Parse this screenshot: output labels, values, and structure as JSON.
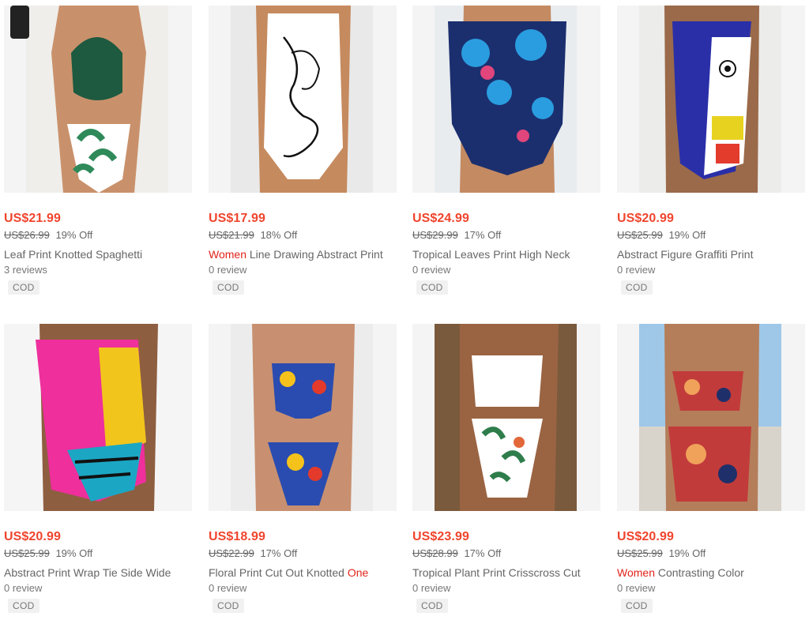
{
  "products": [
    {
      "price": "US$21.99",
      "old_price": "US$26.99",
      "discount": "19% Off",
      "title_highlight": "",
      "title": "Leaf Print Knotted Spaghetti",
      "reviews": "3 reviews",
      "badge": "COD",
      "colors": {
        "bg": "#f3f3f1",
        "suit": "#1d5a40",
        "pattern": "#ffffff",
        "accent": "#2f8a5a",
        "skin": "#c9916b"
      }
    },
    {
      "price": "US$17.99",
      "old_price": "US$21.99",
      "discount": "18% Off",
      "title_highlight": "Women",
      "title": " Line Drawing Abstract Print",
      "reviews": "0 review",
      "badge": "COD",
      "colors": {
        "bg": "#e9e9e9",
        "suit": "#ffffff",
        "pattern": "#111111",
        "accent": "#222222",
        "skin": "#c58a5e"
      }
    },
    {
      "price": "US$24.99",
      "old_price": "US$29.99",
      "discount": "17% Off",
      "title_highlight": "",
      "title": "Tropical Leaves Print High Neck",
      "reviews": "0 review",
      "badge": "COD",
      "colors": {
        "bg": "#e8ecef",
        "suit": "#1b2f6e",
        "pattern": "#2a9de0",
        "accent": "#e0457b",
        "skin": "#c48a62"
      }
    },
    {
      "price": "US$20.99",
      "old_price": "US$25.99",
      "discount": "19% Off",
      "title_highlight": "",
      "title": "Abstract Figure Graffiti Print",
      "reviews": "0 review",
      "badge": "COD",
      "colors": {
        "bg": "#ececea",
        "suit": "#2a2fa8",
        "pattern": "#e8d220",
        "accent": "#e33b2c",
        "skin": "#9a6a4a"
      }
    },
    {
      "price": "US$20.99",
      "old_price": "US$25.99",
      "discount": "19% Off",
      "title_highlight": "",
      "title": "Abstract Print Wrap Tie Side Wide",
      "reviews": "0 review",
      "badge": "COD",
      "colors": {
        "bg": "#f5f5f5",
        "suit": "#ee2f9c",
        "pattern": "#f2c51c",
        "accent": "#1ba7c4",
        "skin": "#8e5e40"
      }
    },
    {
      "price": "US$18.99",
      "old_price": "US$22.99",
      "discount": "17% Off",
      "title_highlight": "",
      "title": "Floral Print Cut Out Knotted ",
      "title_tail": "One",
      "reviews": "0 review",
      "badge": "COD",
      "colors": {
        "bg": "#ececec",
        "suit": "#2a4cb0",
        "pattern": "#f5c21b",
        "accent": "#e33a2b",
        "skin": "#c89070"
      }
    },
    {
      "price": "US$23.99",
      "old_price": "US$28.99",
      "discount": "17% Off",
      "title_highlight": "",
      "title": "Tropical Plant Print Crisscross Cut",
      "reviews": "0 review",
      "badge": "COD",
      "colors": {
        "bg": "#7a5a3c",
        "suit": "#ffffff",
        "pattern": "#2e7d4b",
        "accent": "#e2683a",
        "skin": "#9a6442"
      }
    },
    {
      "price": "US$20.99",
      "old_price": "US$25.99",
      "discount": "19% Off",
      "title_highlight": "Women",
      "title": " Contrasting Color",
      "reviews": "0 review",
      "badge": "COD",
      "colors": {
        "bg": "#9fc8e8",
        "suit": "#c23b3b",
        "pattern": "#f0a25a",
        "accent": "#1f2f6a",
        "skin": "#b47e5a"
      }
    }
  ]
}
